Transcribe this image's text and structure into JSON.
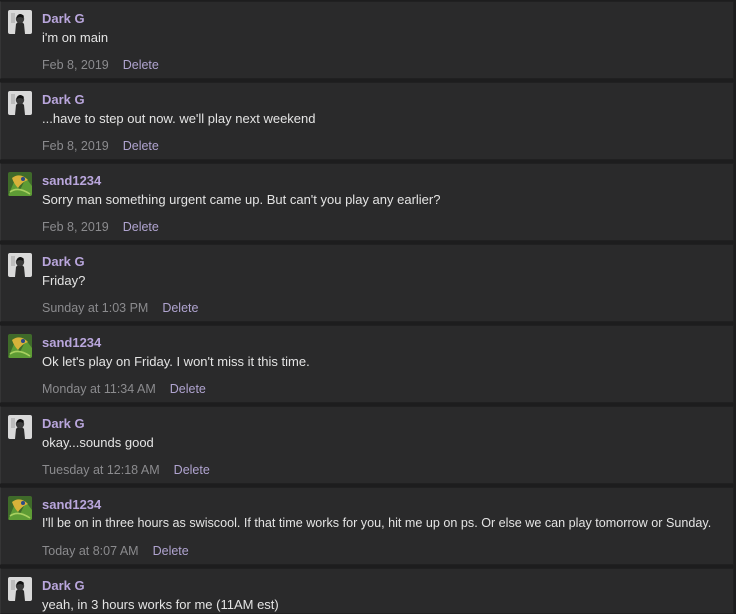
{
  "messages": [
    {
      "author": "Dark G",
      "avatar_icon": "dark-g-avatar",
      "text": "i'm on main",
      "time": "Feb 8, 2019",
      "delete_label": "Delete"
    },
    {
      "author": "Dark G",
      "avatar_icon": "dark-g-avatar",
      "text": "...have to step out now. we'll play next weekend",
      "time": "Feb 8, 2019",
      "delete_label": "Delete"
    },
    {
      "author": "sand1234",
      "avatar_icon": "sand1234-avatar",
      "text": "Sorry man something urgent came up. But can't you play any earlier?",
      "time": "Feb 8, 2019",
      "delete_label": "Delete"
    },
    {
      "author": "Dark G",
      "avatar_icon": "dark-g-avatar",
      "text": "Friday?",
      "time": "Sunday at 1:03 PM",
      "delete_label": "Delete"
    },
    {
      "author": "sand1234",
      "avatar_icon": "sand1234-avatar",
      "text": "Ok let's play on Friday. I won't miss it this time.",
      "time": "Monday at 11:34 AM",
      "delete_label": "Delete"
    },
    {
      "author": "Dark G",
      "avatar_icon": "dark-g-avatar",
      "text": "okay...sounds good",
      "time": "Tuesday at 12:18 AM",
      "delete_label": "Delete"
    },
    {
      "author": "sand1234",
      "avatar_icon": "sand1234-avatar",
      "text": "I'll be on in three hours as swiscool. If that time works for you, hit me up on ps. Or else we can play tomorrow or Sunday.",
      "time": "Today at 8:07 AM",
      "delete_label": "Delete"
    },
    {
      "author": "Dark G",
      "avatar_icon": "dark-g-avatar",
      "text": "yeah, in 3 hours works for me (11AM est)",
      "time": "",
      "delete_label": ""
    }
  ],
  "colors": {
    "background": "#1d1d1e",
    "card": "#2a2a2b",
    "author": "#b9a6dc",
    "text": "#e4e4e4",
    "meta": "#8b8b8e",
    "link": "#b0a4d0"
  }
}
